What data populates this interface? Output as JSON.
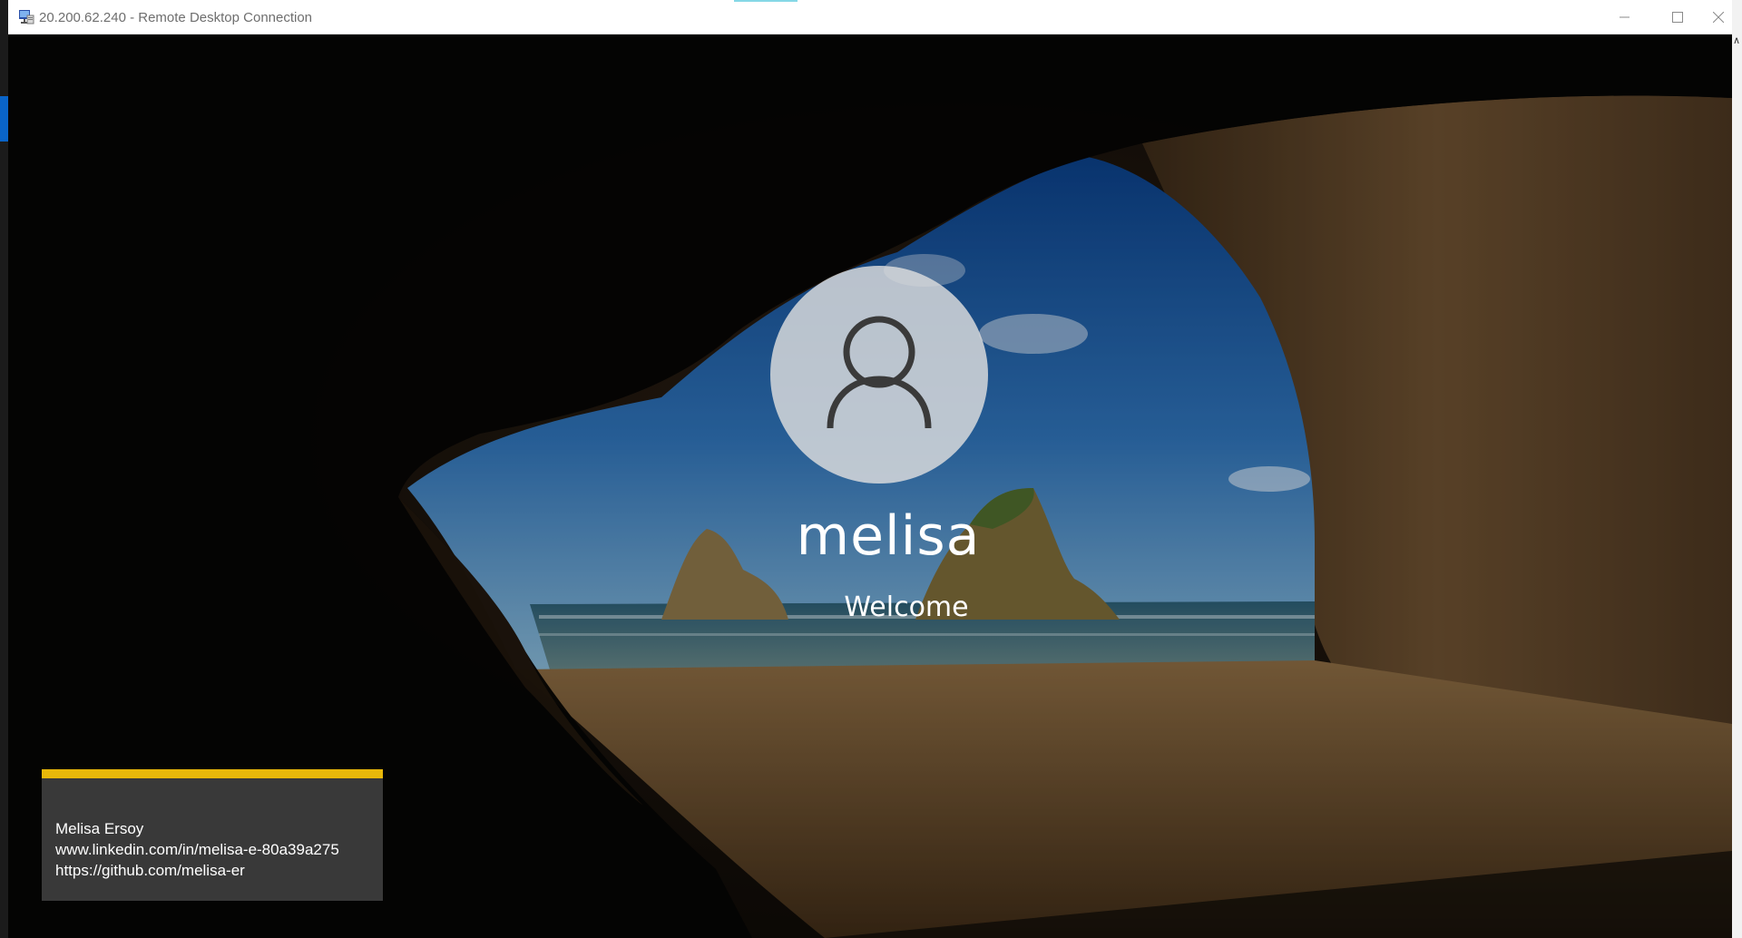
{
  "window": {
    "title": "20.200.62.240 - Remote Desktop Connection",
    "icon": "remote-desktop-icon",
    "controls": {
      "minimize": "minimize-icon",
      "maximize": "maximize-icon",
      "close": "close-icon"
    }
  },
  "lock_screen": {
    "avatar_icon": "user-icon",
    "username": "melisa",
    "status": "Welcome"
  },
  "overlay_card": {
    "accent_color": "#e8b80a",
    "lines": [
      "Melisa Ersoy",
      "www.linkedin.com/in/melisa-e-80a39a275",
      "https://github.com/melisa-er"
    ]
  }
}
